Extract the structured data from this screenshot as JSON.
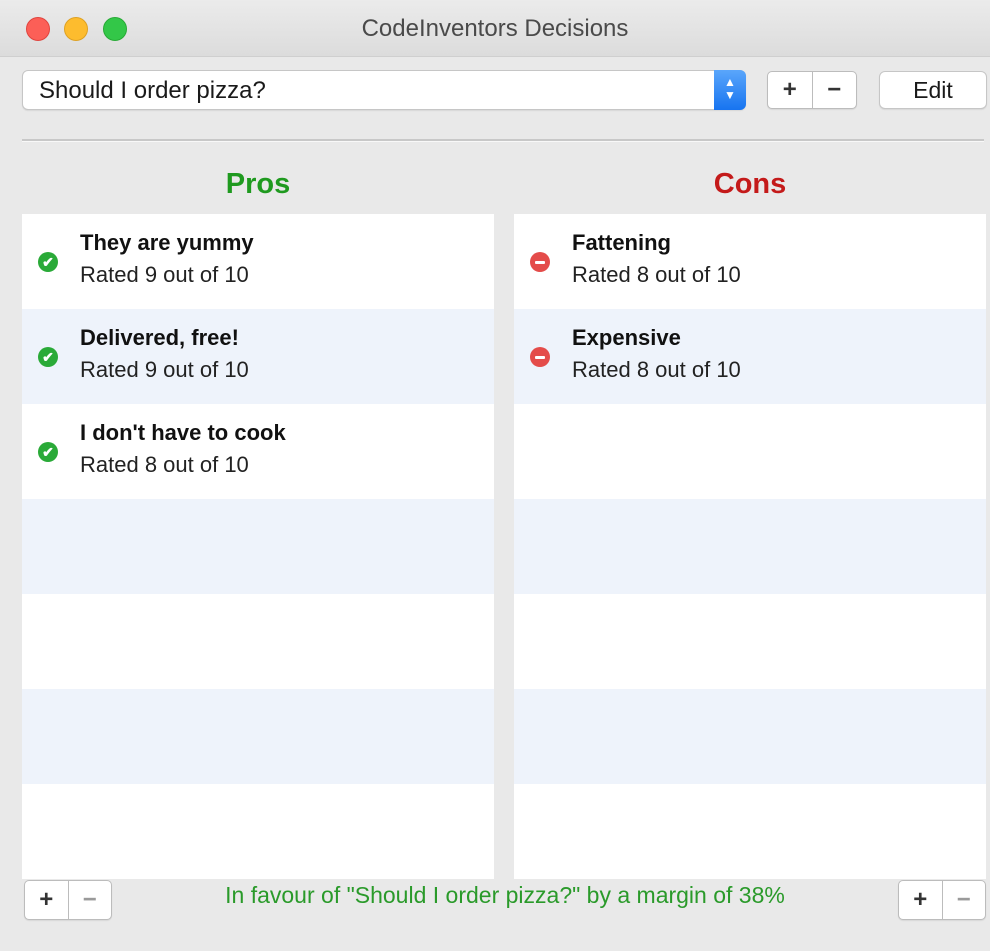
{
  "window": {
    "title": "CodeInventors Decisions"
  },
  "toolbar": {
    "selected_decision": "Should I order pizza?",
    "add_label": "+",
    "remove_label": "−",
    "edit_label": "Edit"
  },
  "pros": {
    "heading": "Pros",
    "color": "#1f9a1f",
    "items": [
      {
        "title": "They are yummy",
        "rating": "Rated 9 out of 10"
      },
      {
        "title": "Delivered, free!",
        "rating": "Rated 9 out of 10"
      },
      {
        "title": "I don't have to cook",
        "rating": "Rated 8 out of 10"
      }
    ]
  },
  "cons": {
    "heading": "Cons",
    "color": "#c41a1a",
    "items": [
      {
        "title": "Fattening",
        "rating": "Rated 8 out of 10"
      },
      {
        "title": "Expensive",
        "rating": "Rated 8 out of 10"
      }
    ]
  },
  "footer": {
    "add_label": "+",
    "remove_label": "−",
    "status_text": "In favour of \"Should I order pizza?\" by a margin of 38%"
  }
}
